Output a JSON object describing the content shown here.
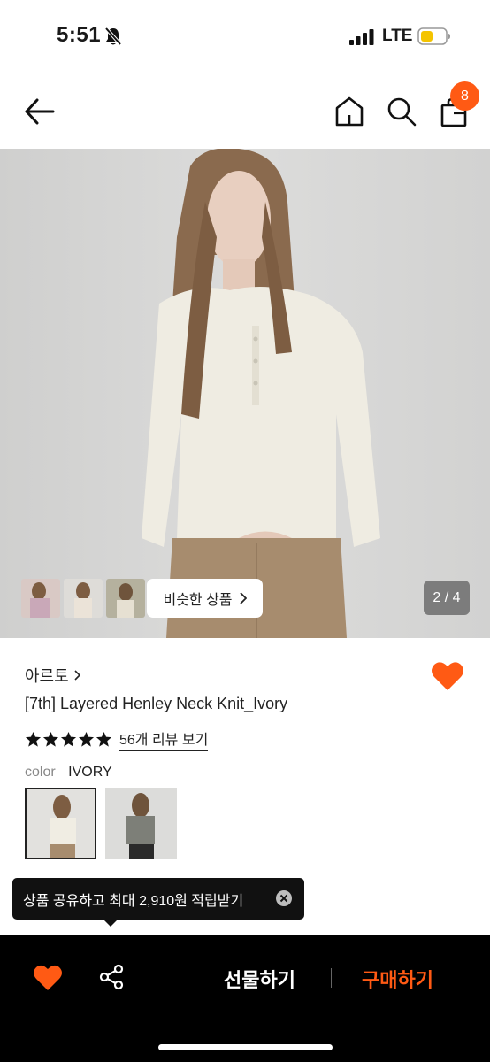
{
  "status_bar": {
    "time": "5:51",
    "network": "LTE",
    "bell_icon": "bell-slash-icon",
    "signal_icon": "cellular-signal-icon",
    "battery_icon": "battery-low-icon",
    "battery_color": "#f4c400"
  },
  "nav": {
    "back_icon": "back-arrow-icon",
    "home_icon": "home-icon",
    "search_icon": "search-icon",
    "bag_icon": "shopping-bag-icon",
    "cart_count": "8",
    "accent_color": "#ff5a14"
  },
  "gallery": {
    "similar_products_label": "비슷한 상품",
    "page_indicator": "2 / 4"
  },
  "product": {
    "brand": "아르토",
    "name": "[7th] Layered Henley Neck Knit_Ivory",
    "rating_stars": 5,
    "review_link": "56개 리뷰 보기",
    "color_label": "color",
    "color_value": "IVORY",
    "wishlisted": true
  },
  "tooltip": {
    "text": "상품 공유하고 최대 2,910원 적립받기"
  },
  "bottom_bar": {
    "gift_label": "선물하기",
    "buy_label": "구매하기",
    "heart_icon": "heart-filled-icon",
    "share_icon": "share-icon"
  }
}
